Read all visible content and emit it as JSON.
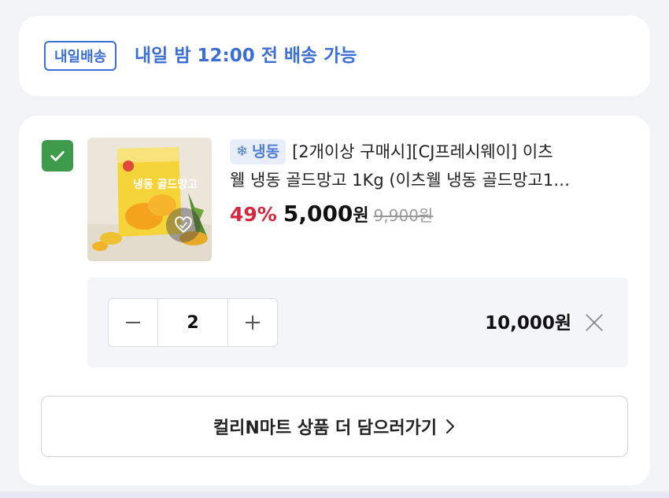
{
  "delivery": {
    "badge": "내일배송",
    "message": "내일 밤 12:00 전 배송 가능"
  },
  "product": {
    "checked": true,
    "storage_badge": "냉동",
    "storage_icon": "snowflake-icon",
    "title_line1": "[2개이상 구매시][CJ프레시웨이] 이츠",
    "title_line2": "웰 냉동 골드망고 1Kg (이츠웰 냉동 골드망고1…",
    "discount": "49%",
    "sale_price": "5,000",
    "sale_unit": "원",
    "original_price": "9,900원",
    "package_text": "냉동 골드망고"
  },
  "quantity": {
    "decrease_label": "−",
    "value": "2",
    "increase_label": "+"
  },
  "line_total": "10,000원",
  "more_button": {
    "label": "컬리N마트 상품 더 담으러가기"
  },
  "colors": {
    "accent_blue": "#3b6fd6",
    "check_green": "#3f9b4c",
    "discount_red": "#d7263d"
  }
}
